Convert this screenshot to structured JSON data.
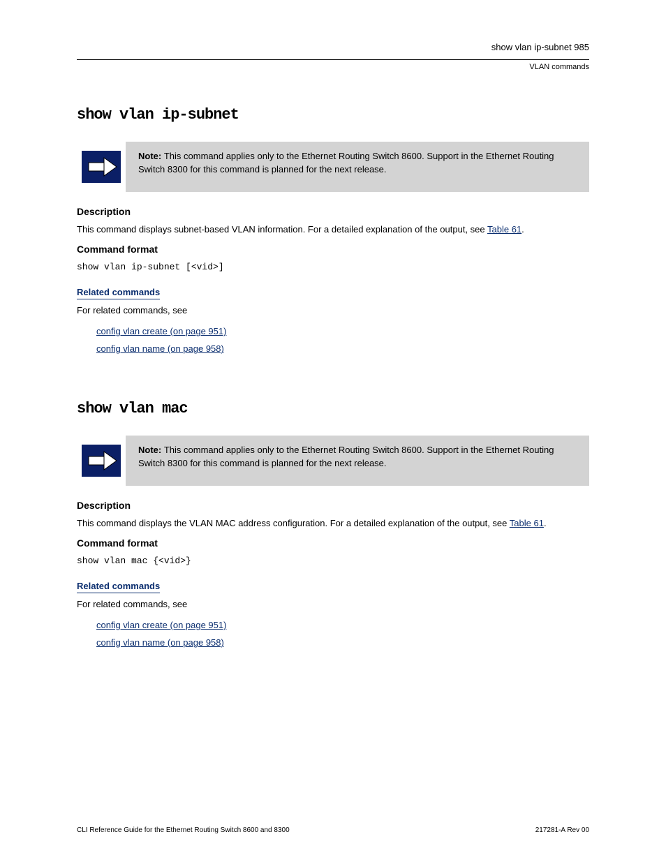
{
  "header": {
    "page_number": "show vlan ip-subnet 985",
    "section": "VLAN commands"
  },
  "sections": [
    {
      "id": "show-vlan-ip-subnet",
      "heading": "show vlan ip-subnet",
      "note": {
        "bold_prefix": "Note: ",
        "text": "This command applies only to the Ethernet Routing Switch 8600. Support in the Ethernet Routing Switch 8300 for this command is planned for the next release."
      },
      "description": {
        "label": "Description",
        "text_before": "This command displays subnet-based VLAN information. For a detailed explanation of the output, see ",
        "link_text": "Table 61",
        "text_after": "."
      },
      "format": {
        "label": "Command format",
        "command": "show vlan ip-subnet [<vid>]"
      },
      "related": {
        "label": "Related commands",
        "intro": "For related commands, see",
        "links": [
          "config vlan create (on page 951)",
          "config vlan name (on page 958)"
        ]
      }
    },
    {
      "id": "show-vlan-mac",
      "heading": "show vlan mac",
      "note": {
        "bold_prefix": "Note: ",
        "text": "This command applies only to the Ethernet Routing Switch 8600. Support in the Ethernet Routing Switch 8300 for this command is planned for the next release."
      },
      "description": {
        "label": "Description",
        "text_before": "This command displays the VLAN MAC address configuration. For a detailed explanation of the output, see ",
        "link_text": "Table 61",
        "text_after": "."
      },
      "format": {
        "label": "Command format",
        "command": "show vlan mac {<vid>}"
      },
      "related": {
        "label": "Related commands",
        "intro": "For related commands, see",
        "links": [
          "config vlan create (on page 951)",
          "config vlan name (on page 958)"
        ]
      }
    }
  ],
  "footer": {
    "left": "CLI Reference Guide for the Ethernet Routing Switch 8600 and 8300",
    "right": "217281-A Rev 00"
  }
}
